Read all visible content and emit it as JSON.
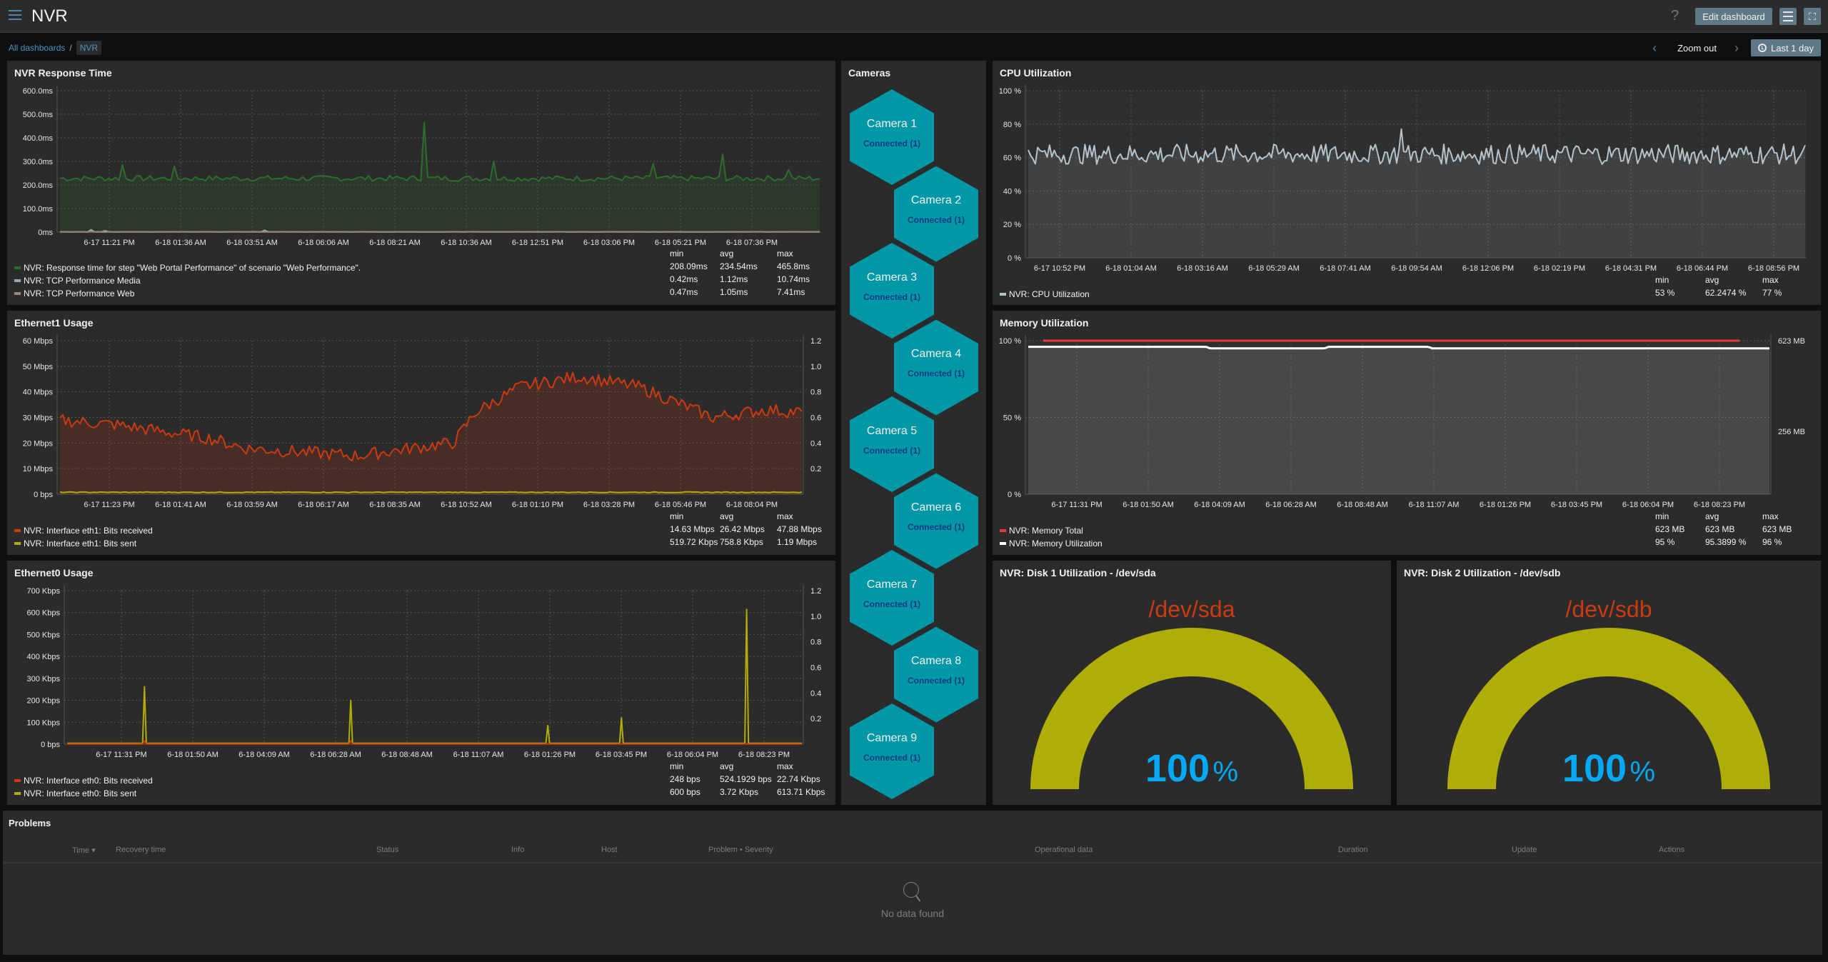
{
  "app": {
    "title": "NVR",
    "help": "?",
    "edit_dashboard": "Edit dashboard",
    "kiosk_icon": "⛶"
  },
  "breadcrumb": {
    "root": "All dashboards",
    "separator": "/",
    "current": "NVR"
  },
  "timeframe": {
    "prev": "‹",
    "zoom_out": "Zoom out",
    "next": "›",
    "range": "Last 1 day"
  },
  "colors": {
    "panel_bg": "#2b2b2b",
    "page_bg": "#0e0f11",
    "accent": "#5f7886",
    "link": "#4796c4",
    "camera_hex": "#0097a7",
    "gauge_arc": "#b0ad06",
    "gauge_value": "#03a9f4",
    "gauge_label": "#cc3a10"
  },
  "panels": {
    "response_time": {
      "title": "NVR Response Time",
      "stats_header": [
        "min",
        "avg",
        "max"
      ],
      "legend": [
        {
          "label": "NVR: Response time for step \"Web Portal Performance\" of scenario \"Web Performance\".",
          "color": "#2d6e2d",
          "min": "208.09ms",
          "avg": "234.54ms",
          "max": "465.8ms"
        },
        {
          "label": "NVR: TCP Performance Media",
          "color": "#9aa9b3",
          "min": "0.42ms",
          "avg": "1.12ms",
          "max": "10.74ms"
        },
        {
          "label": "NVR: TCP Performance Web",
          "color": "#a08478",
          "min": "0.47ms",
          "avg": "1.05ms",
          "max": "7.41ms"
        }
      ]
    },
    "eth1": {
      "title": "Ethernet1 Usage",
      "stats_header": [
        "min",
        "avg",
        "max"
      ],
      "legend": [
        {
          "label": "NVR: Interface eth1: Bits received",
          "color": "#cc3a10",
          "min": "14.63 Mbps",
          "avg": "26.42 Mbps",
          "max": "47.88 Mbps"
        },
        {
          "label": "NVR: Interface eth1: Bits sent",
          "color": "#b0ad06",
          "min": "519.72 Kbps",
          "avg": "758.8 Kbps",
          "max": "1.19 Mbps"
        }
      ]
    },
    "eth0": {
      "title": "Ethernet0 Usage",
      "stats_header": [
        "min",
        "avg",
        "max"
      ],
      "legend": [
        {
          "label": "NVR: Interface eth0: Bits received",
          "color": "#cc3a10",
          "min": "248 bps",
          "avg": "524.1929 bps",
          "max": "22.74 Kbps"
        },
        {
          "label": "NVR: Interface eth0: Bits sent",
          "color": "#b0ad06",
          "min": "600 bps",
          "avg": "3.72 Kbps",
          "max": "613.71 Kbps"
        }
      ]
    },
    "cpu": {
      "title": "CPU Utilization",
      "stats_header": [
        "min",
        "avg",
        "max"
      ],
      "legend": [
        {
          "label": "NVR: CPU Utilization",
          "color": "#b4c3cc",
          "min": "53 %",
          "avg": "62.2474 %",
          "max": "77 %"
        }
      ]
    },
    "memory": {
      "title": "Memory Utilization",
      "stats_header": [
        "min",
        "avg",
        "max"
      ],
      "legend": [
        {
          "label": "NVR: Memory Total",
          "color": "#e53935",
          "min": "623 MB",
          "avg": "623 MB",
          "max": "623 MB"
        },
        {
          "label": "NVR: Memory Utilization",
          "color": "#ffffff",
          "min": "95 %",
          "avg": "95.3899 %",
          "max": "96 %"
        }
      ]
    },
    "cameras": {
      "title": "Cameras",
      "items": [
        {
          "name": "Camera 1",
          "status": "Connected (1)"
        },
        {
          "name": "Camera 2",
          "status": "Connected (1)"
        },
        {
          "name": "Camera 3",
          "status": "Connected (1)"
        },
        {
          "name": "Camera 4",
          "status": "Connected (1)"
        },
        {
          "name": "Camera 5",
          "status": "Connected (1)"
        },
        {
          "name": "Camera 6",
          "status": "Connected (1)"
        },
        {
          "name": "Camera 7",
          "status": "Connected (1)"
        },
        {
          "name": "Camera 8",
          "status": "Connected (1)"
        },
        {
          "name": "Camera 9",
          "status": "Connected (1)"
        }
      ]
    },
    "disk1": {
      "title": "NVR: Disk 1 Utilization - /dev/sda",
      "label": "/dev/sda",
      "value": "100",
      "unit": "%",
      "fraction": 1.0
    },
    "disk2": {
      "title": "NVR: Disk 2 Utilization - /dev/sdb",
      "label": "/dev/sdb",
      "value": "100",
      "unit": "%",
      "fraction": 1.0
    },
    "problems": {
      "title": "Problems",
      "columns": [
        "Time ▾",
        "Recovery time",
        "Status",
        "Info",
        "Host",
        "Problem • Severity",
        "Operational data",
        "Duration",
        "Update",
        "Actions"
      ],
      "empty_text": "No data found"
    }
  },
  "chart_data": [
    {
      "id": "response_time",
      "type": "line",
      "title": "NVR Response Time",
      "x_ticks": [
        "6-17 11:21 PM",
        "6-18 01:36 AM",
        "6-18 03:51 AM",
        "6-18 06:06 AM",
        "6-18 08:21 AM",
        "6-18 10:36 AM",
        "6-18 12:51 PM",
        "6-18 03:06 PM",
        "6-18 05:21 PM",
        "6-18 07:36 PM"
      ],
      "y_ticks": [
        "0ms",
        "100.0ms",
        "200.0ms",
        "300.0ms",
        "400.0ms",
        "500.0ms",
        "600.0ms"
      ],
      "ylim": [
        0,
        600
      ],
      "grid": true,
      "series": [
        {
          "name": "Web Portal Performance",
          "color": "#2d6e2d",
          "fill": true,
          "baseline": 228,
          "noise": 12,
          "spikes": [
            [
              0.08,
              285
            ],
            [
              0.15,
              280
            ],
            [
              0.48,
              465
            ],
            [
              0.57,
              300
            ],
            [
              0.78,
              290
            ],
            [
              0.87,
              330
            ],
            [
              0.96,
              265
            ]
          ]
        },
        {
          "name": "TCP Performance Media",
          "color": "#9aa9b3",
          "baseline": 1.1,
          "noise": 0.5,
          "spikes": [
            [
              0.04,
              10
            ],
            [
              0.27,
              8
            ]
          ]
        },
        {
          "name": "TCP Performance Web",
          "color": "#a08478",
          "baseline": 1.0,
          "noise": 0.5,
          "spikes": [
            [
              0.06,
              7
            ]
          ]
        }
      ]
    },
    {
      "id": "eth1",
      "type": "area",
      "title": "Ethernet1 Usage",
      "x_ticks": [
        "6-17 11:23 PM",
        "6-18 01:41 AM",
        "6-18 03:59 AM",
        "6-18 06:17 AM",
        "6-18 08:35 AM",
        "6-18 10:52 AM",
        "6-18 01:10 PM",
        "6-18 03:28 PM",
        "6-18 05:46 PM",
        "6-18 08:04 PM"
      ],
      "y_ticks": [
        "0 bps",
        "10 Mbps",
        "20 Mbps",
        "30 Mbps",
        "40 Mbps",
        "50 Mbps",
        "60 Mbps"
      ],
      "y2_ticks": [
        "0.2",
        "0.4",
        "0.6",
        "0.8",
        "1.0",
        "1.2"
      ],
      "ylim": [
        0,
        60
      ],
      "grid": true,
      "series": [
        {
          "name": "Bits received",
          "color": "#cc3a10",
          "fill": true,
          "profile": [
            [
              0,
              29
            ],
            [
              0.08,
              27
            ],
            [
              0.15,
              24
            ],
            [
              0.2,
              22
            ],
            [
              0.25,
              18
            ],
            [
              0.3,
              17
            ],
            [
              0.4,
              15
            ],
            [
              0.45,
              17
            ],
            [
              0.5,
              19
            ],
            [
              0.53,
              20
            ],
            [
              0.56,
              32
            ],
            [
              0.62,
              42
            ],
            [
              0.7,
              46
            ],
            [
              0.78,
              42
            ],
            [
              0.83,
              36
            ],
            [
              0.88,
              30
            ],
            [
              0.95,
              33
            ],
            [
              1,
              32
            ]
          ],
          "noise": 2.5
        },
        {
          "name": "Bits sent",
          "color": "#b0ad06",
          "profile": [
            [
              0,
              0.75
            ],
            [
              1,
              0.75
            ]
          ],
          "noise": 0.15
        }
      ]
    },
    {
      "id": "eth0",
      "type": "line",
      "title": "Ethernet0 Usage",
      "x_ticks": [
        "6-17 11:31 PM",
        "6-18 01:50 AM",
        "6-18 04:09 AM",
        "6-18 06:28 AM",
        "6-18 08:48 AM",
        "6-18 11:07 AM",
        "6-18 01:26 PM",
        "6-18 03:45 PM",
        "6-18 06:04 PM",
        "6-18 08:23 PM"
      ],
      "y_ticks": [
        "0 bps",
        "100 Kbps",
        "200 Kbps",
        "300 Kbps",
        "400 Kbps",
        "500 Kbps",
        "600 Kbps",
        "700 Kbps"
      ],
      "y2_ticks": [
        "0.2",
        "0.4",
        "0.6",
        "0.8",
        "1.0",
        "1.2"
      ],
      "ylim": [
        0,
        700
      ],
      "grid": true,
      "series": [
        {
          "name": "Bits sent",
          "color": "#b0ad06",
          "baseline": 4,
          "spikes": [
            [
              0.105,
              262
            ],
            [
              0.385,
              200
            ],
            [
              0.655,
              85
            ],
            [
              0.755,
              120
            ],
            [
              0.925,
              614
            ]
          ]
        },
        {
          "name": "Bits received",
          "color": "#cc3a10",
          "baseline": 0.5,
          "spikes": [
            [
              0.105,
              15
            ],
            [
              0.385,
              15
            ]
          ]
        }
      ]
    },
    {
      "id": "cpu",
      "type": "area",
      "title": "CPU Utilization",
      "x_ticks": [
        "6-17 10:52 PM",
        "6-18 01:04 AM",
        "6-18 03:16 AM",
        "6-18 05:29 AM",
        "6-18 07:41 AM",
        "6-18 09:54 AM",
        "6-18 12:06 PM",
        "6-18 02:19 PM",
        "6-18 04:31 PM",
        "6-18 06:44 PM",
        "6-18 08:56 PM"
      ],
      "y_ticks": [
        "0 %",
        "20 %",
        "40 %",
        "60 %",
        "80 %",
        "100 %"
      ],
      "ylim": [
        0,
        100
      ],
      "grid": true,
      "series": [
        {
          "name": "NVR: CPU Utilization",
          "color": "#b4c3cc",
          "fill": true,
          "baseline": 62,
          "noise": 6,
          "spikes": [
            [
              0.48,
              77
            ]
          ]
        }
      ]
    },
    {
      "id": "memory",
      "type": "area",
      "title": "Memory Utilization",
      "x_ticks": [
        "6-17 11:31 PM",
        "6-18 01:50 AM",
        "6-18 04:09 AM",
        "6-18 06:28 AM",
        "6-18 08:48 AM",
        "6-18 11:07 AM",
        "6-18 01:26 PM",
        "6-18 03:45 PM",
        "6-18 06:04 PM",
        "6-18 08:23 PM"
      ],
      "y_ticks": [
        "0 %",
        "50 %",
        "100 %"
      ],
      "y2_ticks": [
        "256 MB",
        "623 MB"
      ],
      "ylim": [
        0,
        100
      ],
      "grid": true,
      "series": [
        {
          "name": "NVR: Memory Total",
          "color": "#e53935",
          "profile": [
            [
              0.02,
              100
            ],
            [
              0.96,
              100
            ]
          ]
        },
        {
          "name": "NVR: Memory Utilization",
          "color": "#ffffff",
          "fill": true,
          "profile": [
            [
              0,
              96
            ],
            [
              0.24,
              96
            ],
            [
              0.245,
              95
            ],
            [
              0.4,
              95
            ],
            [
              0.405,
              96
            ],
            [
              0.54,
              96
            ],
            [
              0.545,
              95
            ],
            [
              1,
              95
            ]
          ]
        }
      ]
    }
  ]
}
